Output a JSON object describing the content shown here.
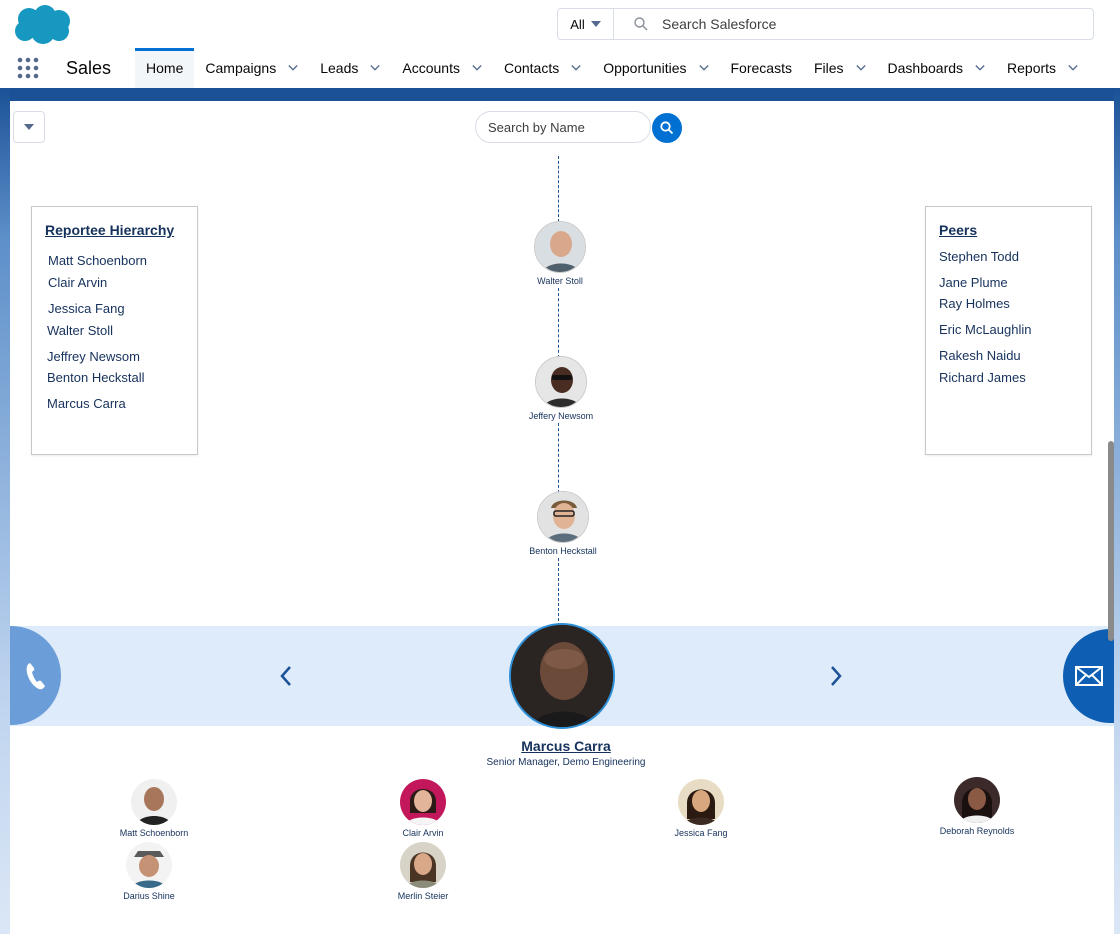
{
  "header": {
    "search_scope": "All",
    "search_placeholder": "Search Salesforce"
  },
  "nav": {
    "app_name": "Sales",
    "items": [
      {
        "label": "Home",
        "active": true,
        "dropdown": false
      },
      {
        "label": "Campaigns",
        "dropdown": true
      },
      {
        "label": "Leads",
        "dropdown": true
      },
      {
        "label": "Accounts",
        "dropdown": true
      },
      {
        "label": "Contacts",
        "dropdown": true
      },
      {
        "label": "Opportunities",
        "dropdown": true
      },
      {
        "label": "Forecasts",
        "dropdown": false
      },
      {
        "label": "Files",
        "dropdown": true
      },
      {
        "label": "Dashboards",
        "dropdown": true
      },
      {
        "label": "Reports",
        "dropdown": true
      }
    ]
  },
  "org": {
    "name_search_placeholder": "Search by Name",
    "managers": [
      "Walter Stoll",
      "Jeffery Newsom",
      "Benton Heckstall"
    ],
    "reportee_hierarchy": {
      "title": "Reportee Hierarchy",
      "items": [
        "Matt Schoenborn",
        "Clair Arvin",
        "Jessica Fang",
        "Walter Stoll",
        "Jeffrey Newsom",
        "Benton Heckstall",
        "Marcus Carra"
      ]
    },
    "peers": {
      "title": "Peers",
      "items": [
        "Stephen Todd",
        "Jane Plume",
        "Ray Holmes",
        "Eric McLaughlin",
        "Rakesh Naidu",
        "Richard James"
      ]
    },
    "focus": {
      "name": "Marcus Carra",
      "title": "Senior Manager, Demo Engineering"
    },
    "reports": [
      "Matt Schoenborn",
      "Clair Arvin",
      "Jessica Fang",
      "Deborah Reynolds",
      "Darius Shine",
      "Merlin Steier"
    ]
  },
  "colors": {
    "brand_blue": "#0070d2",
    "band_blue": "#1b5297",
    "focus_band": "#deebfa",
    "text_navy": "#16325c"
  }
}
